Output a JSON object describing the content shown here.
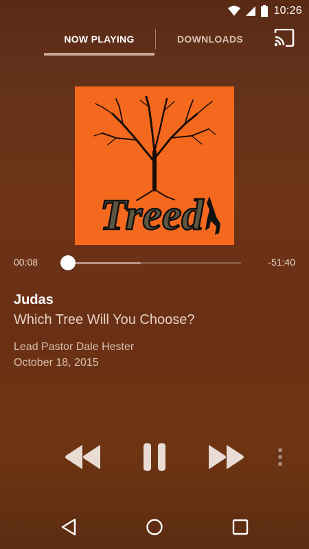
{
  "status_bar": {
    "time": "10:26",
    "icons": [
      "wifi-icon",
      "cell-signal-icon",
      "battery-icon"
    ]
  },
  "tabs": [
    {
      "label": "NOW PLAYING",
      "active": true
    },
    {
      "label": "DOWNLOADS",
      "active": false
    }
  ],
  "cast_icon": "cast-icon",
  "artwork": {
    "logo_text": "Treed",
    "background_color": "#f5691e"
  },
  "playback": {
    "elapsed": "00:08",
    "remaining": "-51:40",
    "progress_fraction": 0.0,
    "buffered_fraction": 0.42
  },
  "track": {
    "title": "Judas",
    "subtitle": "Which Tree Will You Choose?",
    "speaker": "Lead Pastor Dale Hester",
    "date": "October 18, 2015"
  },
  "controls": {
    "rewind_icon": "rewind-icon",
    "pause_icon": "pause-icon",
    "fast_forward_icon": "fast-forward-icon",
    "more_icon": "more-vertical-icon"
  },
  "nav_bar": {
    "icons": [
      "back-icon",
      "home-icon",
      "recents-icon"
    ]
  }
}
